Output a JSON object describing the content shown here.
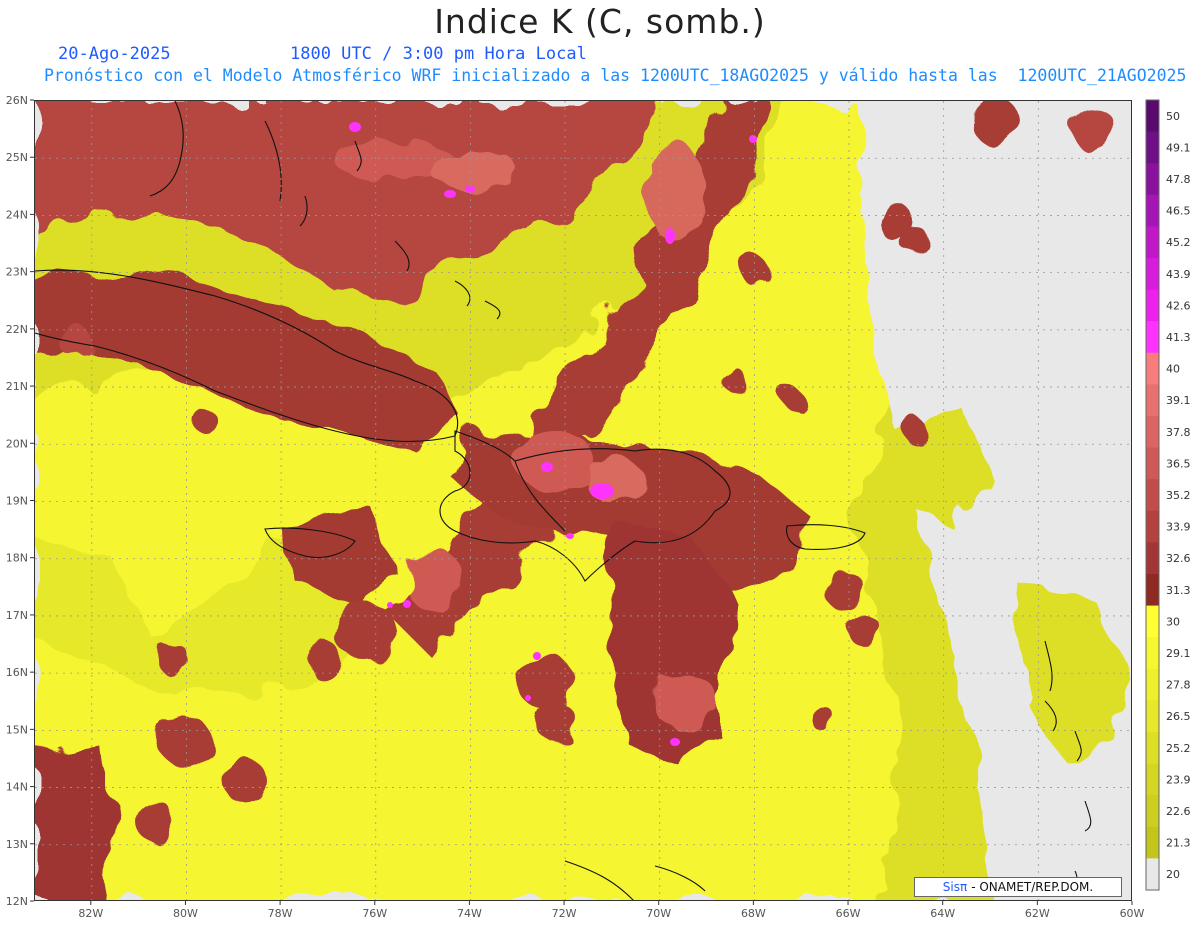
{
  "header": {
    "title": "Indice K (C, somb.)",
    "date": "20-Ago-2025",
    "time": "1800 UTC / 3:00 pm Hora Local",
    "subtitle": "Pronóstico con el Modelo Atmosférico WRF inicializado a las 1200UTC_18AGO2025 y válido hasta las  1200UTC_21AGO2025"
  },
  "map": {
    "lat_labels": [
      "26N",
      "25N",
      "24N",
      "23N",
      "22N",
      "21N",
      "20N",
      "19N",
      "18N",
      "17N",
      "16N",
      "15N",
      "14N",
      "13N",
      "12N"
    ],
    "lon_labels": [
      "82W",
      "80W",
      "78W",
      "76W",
      "74W",
      "72W",
      "70W",
      "68W",
      "66W",
      "64W",
      "62W",
      "60W"
    ],
    "lat_range": [
      12,
      26
    ],
    "lon_range": [
      -83.2,
      -60
    ],
    "grid": true
  },
  "colorbar": {
    "levels": [
      "50",
      "49.1",
      "47.8",
      "46.5",
      "45.2",
      "43.9",
      "42.6",
      "41.3",
      "40",
      "39.1",
      "37.8",
      "36.5",
      "35.2",
      "33.9",
      "32.6",
      "31.3",
      "30",
      "29.1",
      "27.8",
      "26.5",
      "25.2",
      "23.9",
      "22.6",
      "21.3",
      "20"
    ],
    "colors": [
      "#5a0a6e",
      "#6e0f87",
      "#8a119e",
      "#a514b5",
      "#c018c9",
      "#d81cdc",
      "#ec22ec",
      "#ff33ff",
      "#f77d7d",
      "#e97070",
      "#dc6464",
      "#cf5858",
      "#c24c4c",
      "#b44040",
      "#a33535",
      "#8e2a22",
      "#ffff33",
      "#f7f72f",
      "#eef02c",
      "#e6e829",
      "#dddf26",
      "#d4d623",
      "#ccce20",
      "#c3c51d",
      "#e8e8e8"
    ]
  },
  "credit": {
    "sis": "Sisπ",
    "text": "- ONAMET/REP.DOM."
  }
}
